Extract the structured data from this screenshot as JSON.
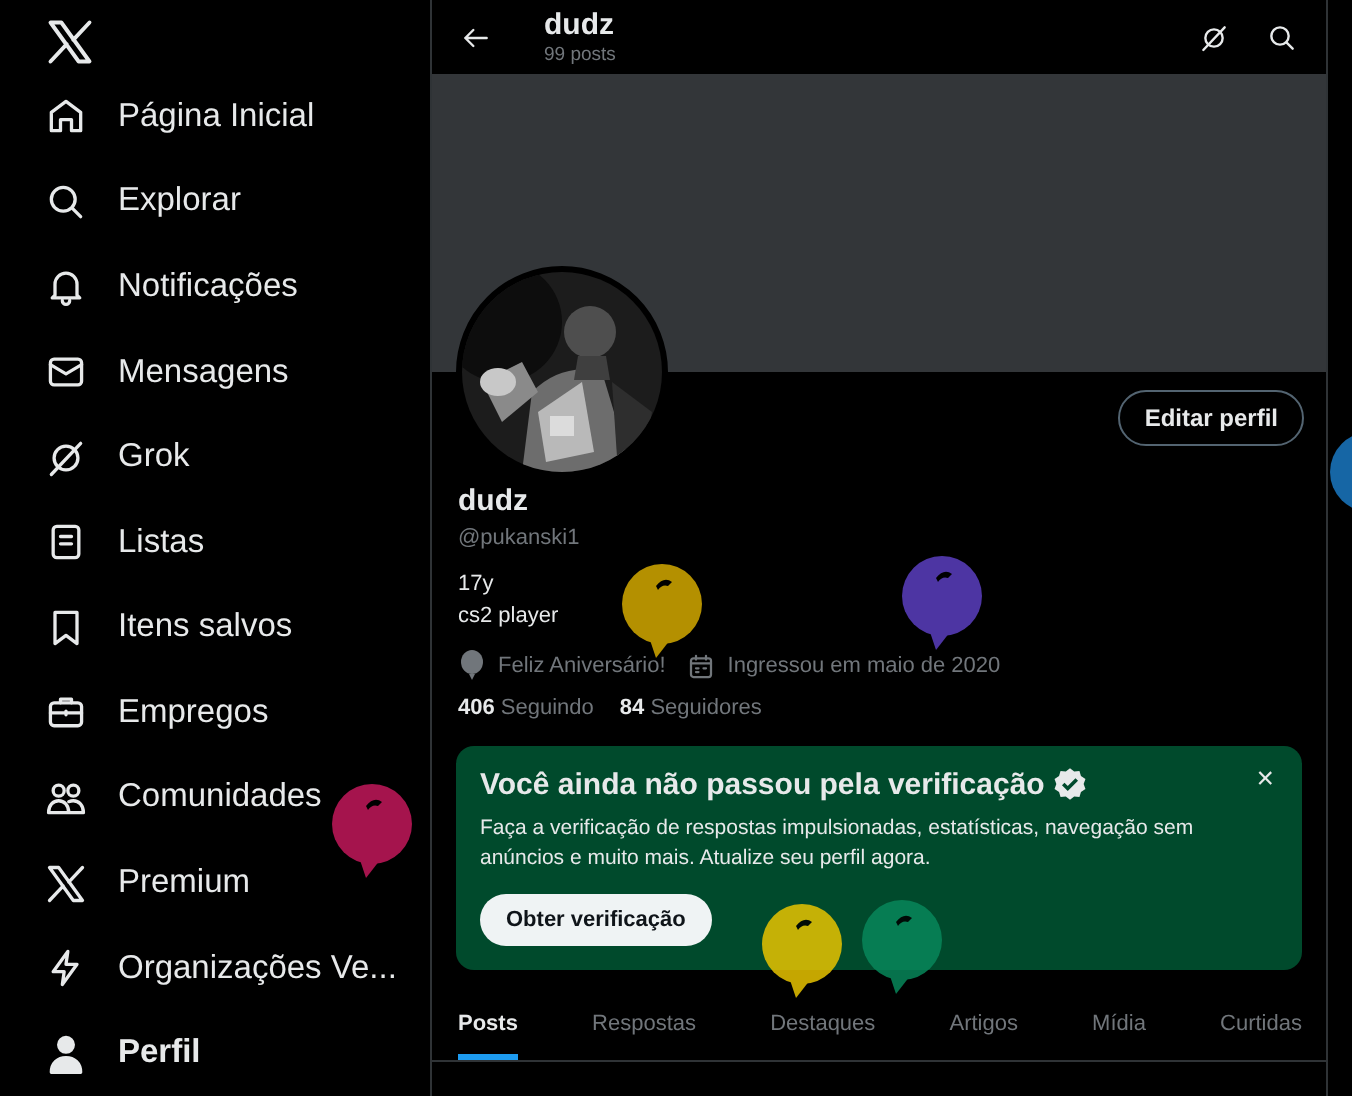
{
  "sidebar": {
    "items": [
      {
        "kind": "home",
        "label": "Página Inicial",
        "selected": false
      },
      {
        "kind": "search",
        "label": "Explorar",
        "selected": false
      },
      {
        "kind": "bell",
        "label": "Notificações",
        "selected": false
      },
      {
        "kind": "mail",
        "label": "Mensagens",
        "selected": false
      },
      {
        "kind": "grok",
        "label": "Grok",
        "selected": false
      },
      {
        "kind": "list",
        "label": "Listas",
        "selected": false
      },
      {
        "kind": "bookmark",
        "label": "Itens salvos",
        "selected": false
      },
      {
        "kind": "briefcase",
        "label": "Empregos",
        "selected": false
      },
      {
        "kind": "people",
        "label": "Comunidades",
        "selected": false
      },
      {
        "kind": "x",
        "label": "Premium",
        "selected": false
      },
      {
        "kind": "bolt",
        "label": "Organizações Ve...",
        "selected": false
      },
      {
        "kind": "person",
        "label": "Perfil",
        "selected": true
      }
    ]
  },
  "header": {
    "title": "dudz",
    "subtitle": "99 posts"
  },
  "profile": {
    "name": "dudz",
    "handle": "@pukanski1",
    "bio": [
      "17y",
      "cs2 player"
    ],
    "birthday": "Feliz Aniversário!",
    "joined": "Ingressou em maio de 2020",
    "following_count": "406",
    "following_label": "Seguindo",
    "followers_count": "84",
    "followers_label": "Seguidores",
    "edit_button": "Editar perfil"
  },
  "promo": {
    "title": "Você ainda não passou pela verificação",
    "text": "Faça a verificação de respostas impulsionadas, estatísticas, navegação sem anúncios e muito mais. Atualize seu perfil agora.",
    "button": "Obter verificação",
    "close": "×"
  },
  "tabs": [
    {
      "label": "Posts",
      "selected": true
    },
    {
      "label": "Respostas",
      "selected": false
    },
    {
      "label": "Destaques",
      "selected": false
    },
    {
      "label": "Artigos",
      "selected": false
    },
    {
      "label": "Mídia",
      "selected": false
    },
    {
      "label": "Curtidas",
      "selected": false
    }
  ]
}
